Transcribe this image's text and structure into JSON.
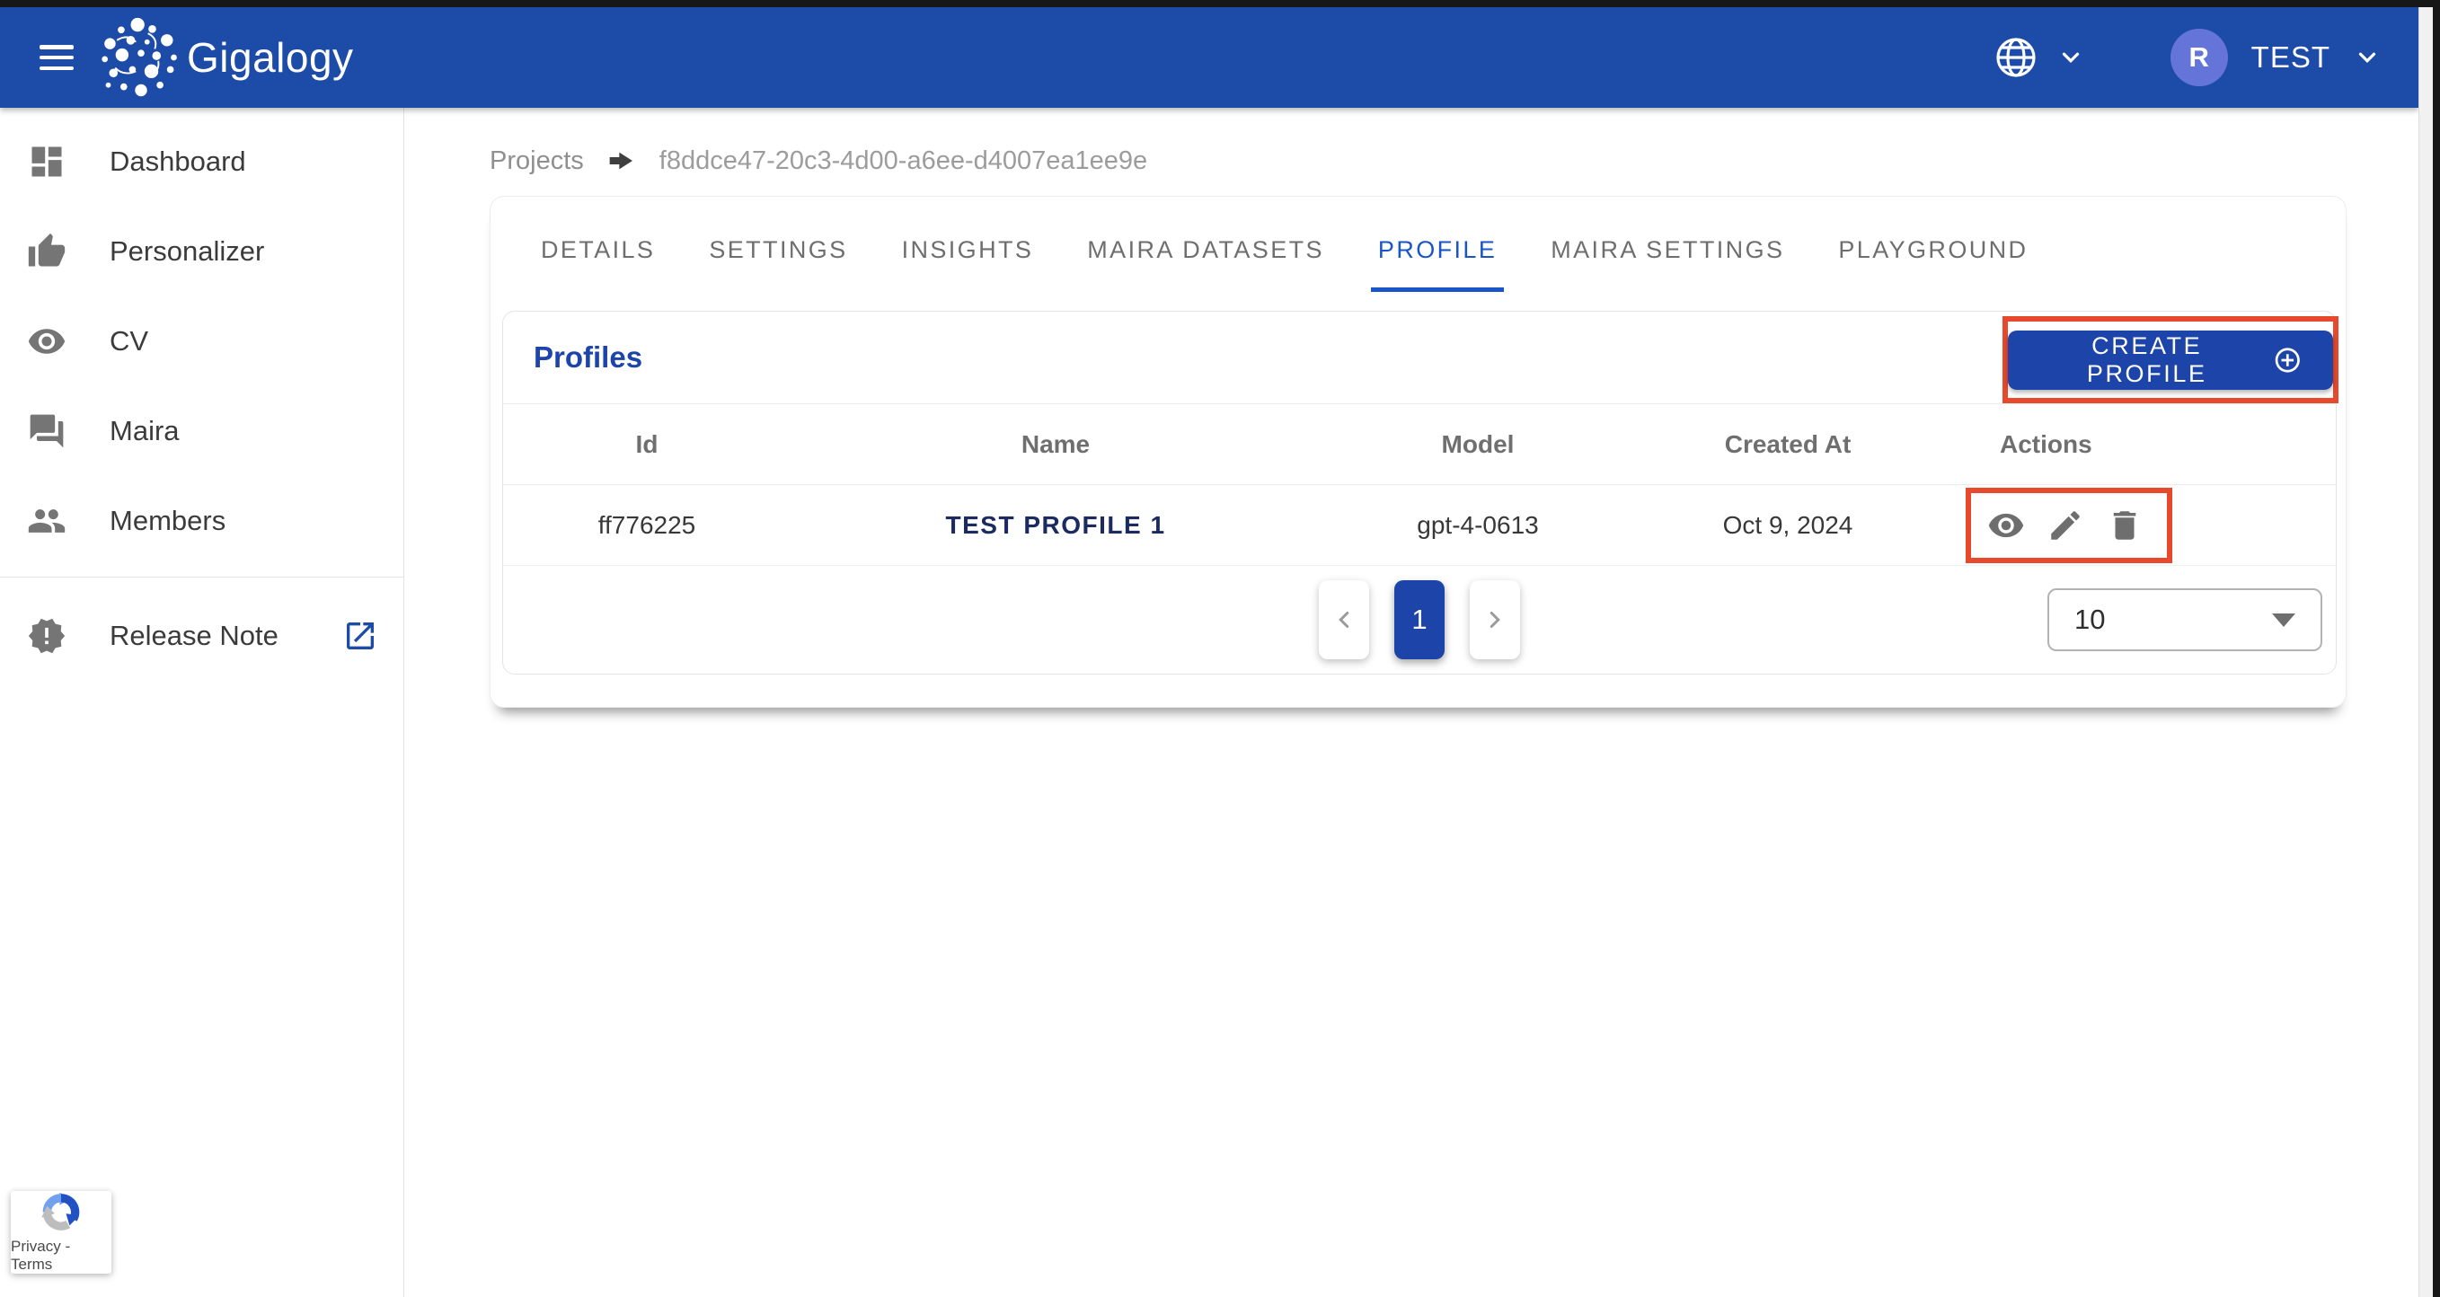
{
  "navbar": {
    "brand": "Gigalogy",
    "user": {
      "initial": "R",
      "name": "TEST"
    }
  },
  "breadcrumb": {
    "root": "Projects",
    "current": "f8ddce47-20c3-4d00-a6ee-d4007ea1ee9e"
  },
  "sidebar": {
    "items": [
      {
        "label": "Dashboard",
        "icon": "dashboard-icon"
      },
      {
        "label": "Personalizer",
        "icon": "thumb-up-icon"
      },
      {
        "label": "CV",
        "icon": "eye-icon"
      },
      {
        "label": "Maira",
        "icon": "chat-icon"
      },
      {
        "label": "Members",
        "icon": "people-icon"
      }
    ],
    "release_note": {
      "label": "Release Note",
      "icon": "new-releases-icon",
      "external_icon": "open-in-new-icon"
    }
  },
  "recaptcha": {
    "label": "Privacy - Terms"
  },
  "tabs": [
    {
      "label": "DETAILS"
    },
    {
      "label": "SETTINGS"
    },
    {
      "label": "INSIGHTS"
    },
    {
      "label": "MAIRA DATASETS"
    },
    {
      "label": "PROFILE",
      "active": true
    },
    {
      "label": "MAIRA SETTINGS"
    },
    {
      "label": "PLAYGROUND"
    }
  ],
  "profiles_panel": {
    "title": "Profiles",
    "create_button": {
      "label": "CREATE PROFILE",
      "icon": "add-circle-icon"
    },
    "table": {
      "columns": [
        "Id",
        "Name",
        "Model",
        "Created At",
        "Actions"
      ],
      "rows": [
        {
          "id": "ff776225",
          "name": "TEST PROFILE 1",
          "model": "gpt-4-0613",
          "created_at": "Oct 9, 2024"
        }
      ],
      "row_actions": [
        "view",
        "edit",
        "delete"
      ]
    },
    "pagination": {
      "page": "1",
      "page_size": "10"
    }
  },
  "colors": {
    "primary": "#1d4ba8",
    "button_blue": "#1c44a9",
    "tab_active": "#1a55c7",
    "panel_title": "#1c44aa",
    "avatar": "#6574d8",
    "annotation_red": "#e8482c"
  }
}
